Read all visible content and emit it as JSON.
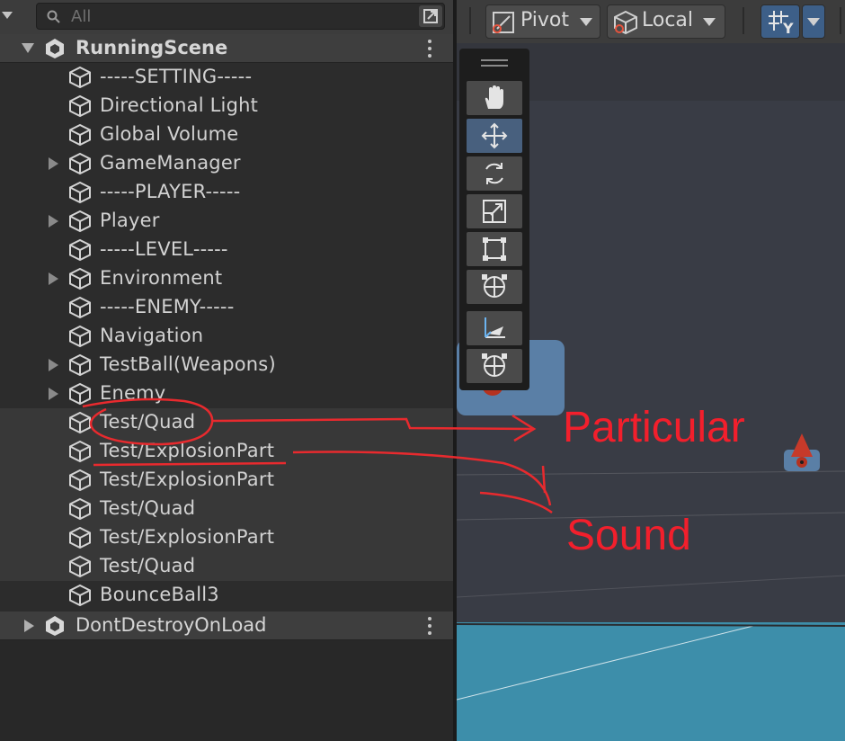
{
  "hierarchy": {
    "search": {
      "placeholder": "All"
    },
    "scenes": [
      {
        "name": "RunningScene"
      },
      {
        "name": "DontDestroyOnLoad"
      }
    ],
    "items": [
      {
        "label": "-----SETTING-----",
        "expandable": false
      },
      {
        "label": "Directional Light",
        "expandable": false
      },
      {
        "label": "Global Volume",
        "expandable": false
      },
      {
        "label": "GameManager",
        "expandable": true
      },
      {
        "label": "-----PLAYER-----",
        "expandable": false
      },
      {
        "label": "Player",
        "expandable": true
      },
      {
        "label": "-----LEVEL-----",
        "expandable": false
      },
      {
        "label": "Environment",
        "expandable": true
      },
      {
        "label": "-----ENEMY-----",
        "expandable": false
      },
      {
        "label": "Navigation",
        "expandable": false
      },
      {
        "label": "TestBall(Weapons)",
        "expandable": true
      },
      {
        "label": "Enemy",
        "expandable": true
      },
      {
        "label": "Test/Quad",
        "expandable": false
      },
      {
        "label": "Test/ExplosionPart",
        "expandable": false
      },
      {
        "label": "Test/ExplosionPart",
        "expandable": false
      },
      {
        "label": "Test/Quad",
        "expandable": false
      },
      {
        "label": "Test/ExplosionPart",
        "expandable": false
      },
      {
        "label": "Test/Quad",
        "expandable": false
      },
      {
        "label": "BounceBall3",
        "expandable": false
      }
    ]
  },
  "scene_toolbar": {
    "pivot_label": "Pivot",
    "local_label": "Local"
  },
  "tools": [
    "hand-tool",
    "move-tool",
    "rotate-tool",
    "scale-tool",
    "rect-tool",
    "transform-tool",
    "custom-editor-tool",
    "custom-transform-tool"
  ],
  "annotations": {
    "particular": "Particular",
    "sound": "Sound"
  },
  "colors": {
    "annotation": "#f21f2c",
    "active_tool": "#48607e",
    "floor": "#3d8eaa"
  }
}
